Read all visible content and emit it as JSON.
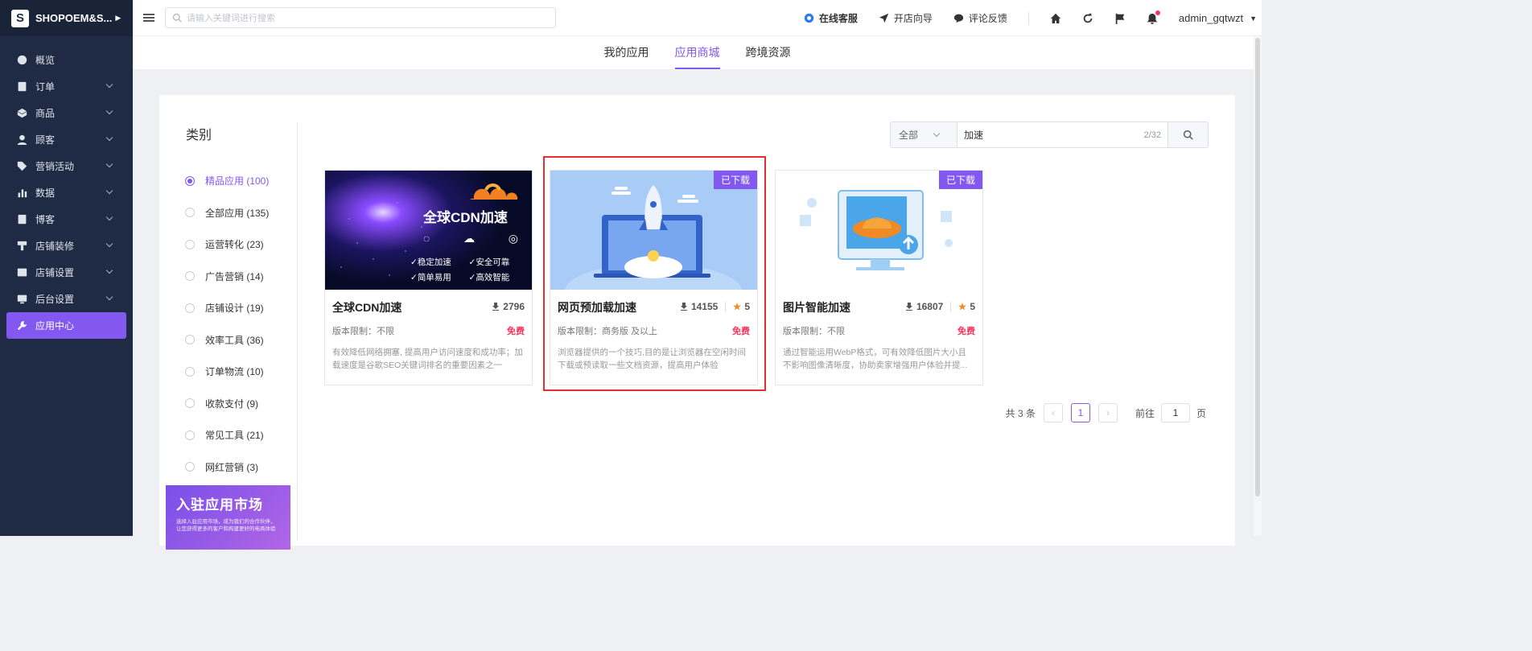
{
  "brand": {
    "logo": "S",
    "name": "SHOPOEM&S..."
  },
  "sidebar": {
    "items": [
      {
        "label": "概览",
        "icon": "dashboard-icon",
        "has_caret": false
      },
      {
        "label": "订单",
        "icon": "order-icon",
        "has_caret": true
      },
      {
        "label": "商品",
        "icon": "product-icon",
        "has_caret": true
      },
      {
        "label": "顾客",
        "icon": "customer-icon",
        "has_caret": true
      },
      {
        "label": "营销活动",
        "icon": "tag-icon",
        "has_caret": true
      },
      {
        "label": "数据",
        "icon": "chart-icon",
        "has_caret": true
      },
      {
        "label": "博客",
        "icon": "blog-icon",
        "has_caret": true
      },
      {
        "label": "店铺装修",
        "icon": "brush-icon",
        "has_caret": true
      },
      {
        "label": "店铺设置",
        "icon": "store-icon",
        "has_caret": true
      },
      {
        "label": "后台设置",
        "icon": "settings-icon",
        "has_caret": true
      },
      {
        "label": "应用中心",
        "icon": "app-center-icon",
        "has_caret": false,
        "active": true
      }
    ]
  },
  "topbar": {
    "search_placeholder": "请输入关键词进行搜索",
    "online_service": "在线客服",
    "store_guide": "开店向导",
    "feedback": "评论反馈",
    "username": "admin_gqtwzt"
  },
  "tabs": [
    {
      "label": "我的应用",
      "active": false
    },
    {
      "label": "应用商城",
      "active": true
    },
    {
      "label": "跨境资源",
      "active": false
    }
  ],
  "categories": {
    "title": "类别",
    "items": [
      {
        "label": "精品应用 (100)",
        "active": true
      },
      {
        "label": "全部应用 (135)"
      },
      {
        "label": "运营转化 (23)"
      },
      {
        "label": "广告营销 (14)"
      },
      {
        "label": "店铺设计 (19)"
      },
      {
        "label": "效率工具 (36)"
      },
      {
        "label": "订单物流 (10)"
      },
      {
        "label": "收款支付 (9)"
      },
      {
        "label": "常见工具 (21)"
      },
      {
        "label": "网红营销 (3)"
      }
    ]
  },
  "banner": {
    "title": "入驻应用市场",
    "subtitle": "选择入驻应用市场，成为我们的合作伙伴，让您获得更多的客户和构建更好的电商体验"
  },
  "search": {
    "select_value": "全部",
    "query": "加速",
    "counter": "2/32"
  },
  "cards": [
    {
      "title": "全球CDN加速",
      "downloads": "2796",
      "rating": "",
      "limit_label": "版本限制：",
      "limit_value": "不限",
      "price": "免费",
      "desc": "有效降低网络拥塞, 提高用户访问速度和成功率；加载速度是谷歌SEO关键词排名的重要因素之一",
      "badge": "",
      "image": {
        "headline": "全球CDN加速",
        "features": [
          "稳定加速",
          "安全可靠",
          "简单易用",
          "高效智能"
        ]
      }
    },
    {
      "title": "网页预加载加速",
      "downloads": "14155",
      "rating": "5",
      "limit_label": "版本限制：",
      "limit_value": "商务版 及以上",
      "price": "免费",
      "desc": "浏览器提供的一个技巧,目的是让浏览器在空闲时间下载或预读取一些文档资源，提高用户体验",
      "badge": "已下载"
    },
    {
      "title": "图片智能加速",
      "downloads": "16807",
      "rating": "5",
      "limit_label": "版本限制：",
      "limit_value": "不限",
      "price": "免费",
      "desc": "通过智能运用WebP格式，可有效降低图片大小且不影响图像清晰度，协助卖家增强用户体验并提...",
      "badge": "已下载"
    }
  ],
  "pagination": {
    "total": "共 3 条",
    "current": "1",
    "goto_label": "前往",
    "goto_value": "1",
    "page_suffix": "页"
  },
  "colors": {
    "accent": "#8258f0",
    "sidebar": "#1f2b44",
    "price": "#f5365c"
  }
}
